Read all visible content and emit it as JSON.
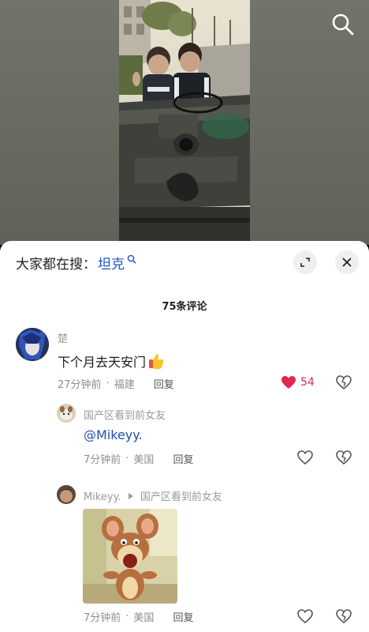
{
  "search_bar": {
    "prefix": "大家都在搜：",
    "keyword": "坦克"
  },
  "comments_count": "75条评论",
  "comments": [
    {
      "user": "楚",
      "text": "下个月去天安门",
      "time": "27分钟前",
      "location": "福建",
      "reply_label": "回复",
      "likes": "54",
      "liked": true
    }
  ],
  "replies": [
    {
      "user": "国产区看到前女友",
      "mention": "@Mikeyy.",
      "time": "7分钟前",
      "location": "美国",
      "reply_label": "回复"
    },
    {
      "user": "Mikeyy.",
      "reply_to": "国产区看到前女友",
      "has_sticker": true,
      "time": "7分钟前",
      "location": "美国",
      "reply_label": "回复"
    }
  ],
  "colors": {
    "like_red": "#e0294f",
    "mention_blue": "#1f4fa8",
    "keyword_blue": "#1f57c3"
  }
}
